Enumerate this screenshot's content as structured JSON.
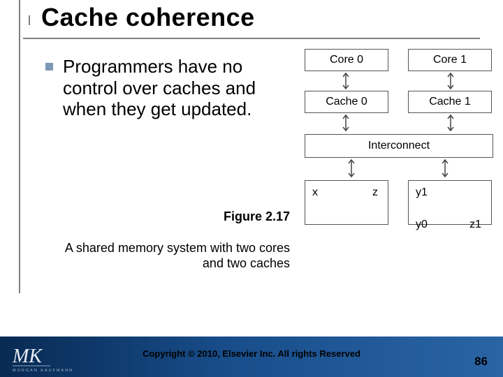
{
  "title": "Cache coherence",
  "bullet": "Programmers have no control over caches and when they get updated.",
  "figure_label": "Figure 2.17",
  "caption": "A shared memory system with two cores and two caches",
  "diagram": {
    "cores": [
      "Core 0",
      "Core 1"
    ],
    "caches": [
      "Cache 0",
      "Cache 1"
    ],
    "interconnect": "Interconnect",
    "mem_left": {
      "a": "x",
      "b": "z"
    },
    "mem_right": {
      "a": "y1",
      "b": "",
      "c": "y0",
      "d": "z1"
    }
  },
  "copyright": "Copyright © 2010, Elsevier Inc. All rights Reserved",
  "page": "86",
  "publisher_initials": "MK",
  "publisher_small": "MORGAN KAUFMANN"
}
